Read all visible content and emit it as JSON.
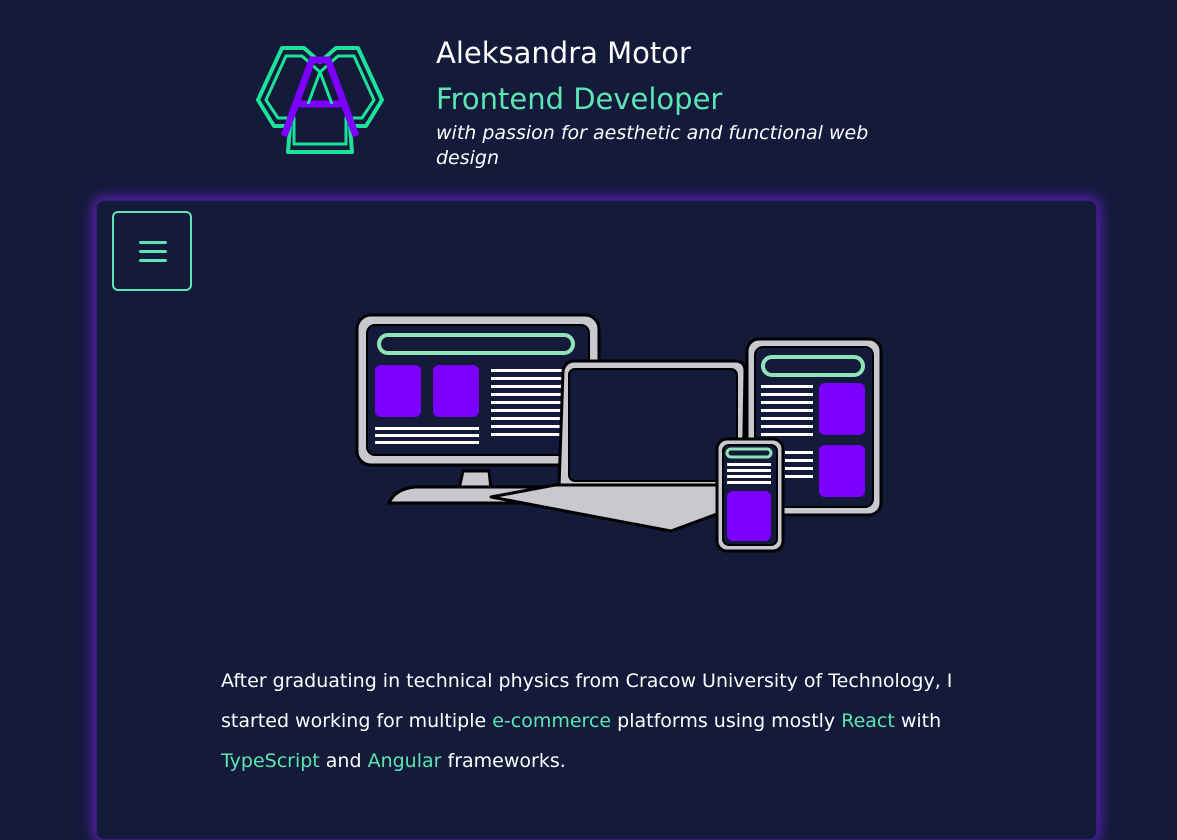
{
  "header": {
    "name": "Aleksandra Motor",
    "role": "Frontend Developer",
    "tagline": "with passion for aesthetic and functional web design",
    "logo_icon": "letter-a-hexagon-logo"
  },
  "menu": {
    "icon": "hamburger-menu-icon"
  },
  "illustration": {
    "icon": "responsive-devices-illustration"
  },
  "intro": {
    "part1": "After graduating in technical physics from Cracow University of Technology, I started working for multiple ",
    "link_ecommerce": "e-commerce",
    "part2": " platforms using mostly ",
    "link_react": "React",
    "part3": " with ",
    "link_typescript": "TypeScript",
    "part4": " and ",
    "link_angular": "Angular",
    "part5": " frameworks."
  },
  "colors": {
    "background": "#131a3a",
    "accent": "#5ce5b0",
    "purple": "#7c00ff",
    "glow": "#7a24e6"
  }
}
